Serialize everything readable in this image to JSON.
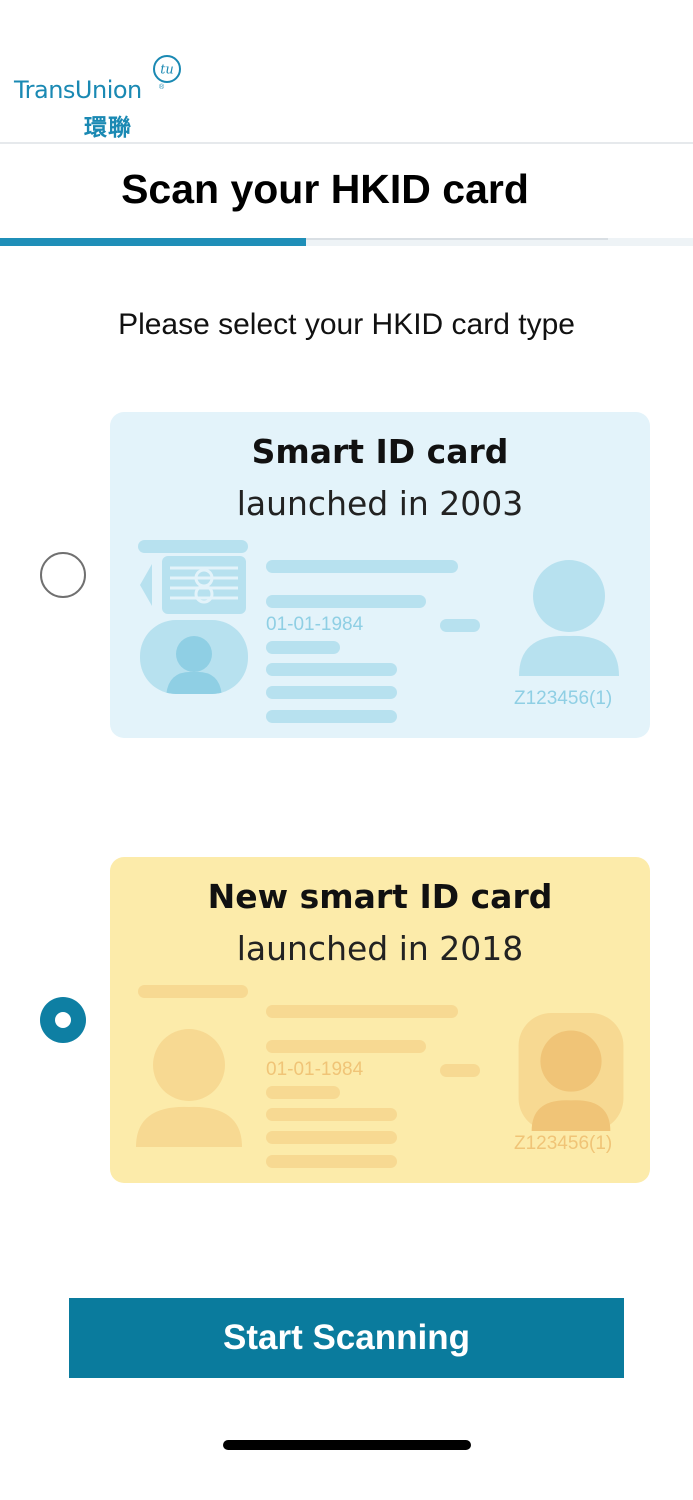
{
  "header": {
    "logo_text": "TransUnion",
    "logo_badge_text": "tu",
    "logo_chinese": "環聯",
    "logo_mark": "®"
  },
  "page": {
    "title": "Scan your HKID card",
    "progress": 0.44,
    "subtitle": "Please select your HKID card type"
  },
  "options": [
    {
      "title": "Smart ID card",
      "subtitle": "launched in 2003",
      "sample_date": "01-01-1984",
      "sample_id": "Z123456(1)",
      "selected": false,
      "color": "#e3f3fa"
    },
    {
      "title": "New smart ID card",
      "subtitle": "launched in 2018",
      "sample_date": "01-01-1984",
      "sample_id": "Z123456(1)",
      "selected": true,
      "color": "#fcebaa"
    }
  ],
  "actions": {
    "start_label": "Start Scanning"
  },
  "colors": {
    "accent": "#0a7b9d",
    "brand": "#1a89b3"
  }
}
